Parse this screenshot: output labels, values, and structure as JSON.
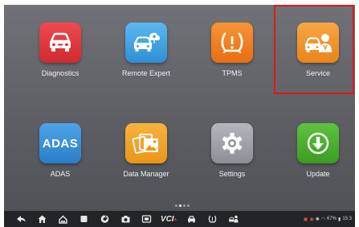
{
  "apps": [
    {
      "label": "Diagnostics",
      "icon": "car-front-icon",
      "color": "#e0333a"
    },
    {
      "label": "Remote Expert",
      "icon": "remote-expert-icon",
      "color": "#3ea5e6"
    },
    {
      "label": "TPMS",
      "icon": "tpms-warning-icon",
      "color": "#f07f1c"
    },
    {
      "label": "Service",
      "icon": "service-technician-icon",
      "color": "#f0962a"
    },
    {
      "label": "ADAS",
      "icon": "adas-icon",
      "color": "#3b8fd9"
    },
    {
      "label": "Data Manager",
      "icon": "photo-stack-icon",
      "color": "#f2a323"
    },
    {
      "label": "Settings",
      "icon": "gear-icon",
      "color": "#9ea2a8"
    },
    {
      "label": "Update",
      "icon": "download-arrow-icon",
      "color": "#49b12e"
    }
  ],
  "adas_text": "ADAS",
  "highlight_color": "#e01818",
  "navbar": {
    "vci_label": "VCI",
    "status_text": "67%",
    "clock": "15:3"
  }
}
